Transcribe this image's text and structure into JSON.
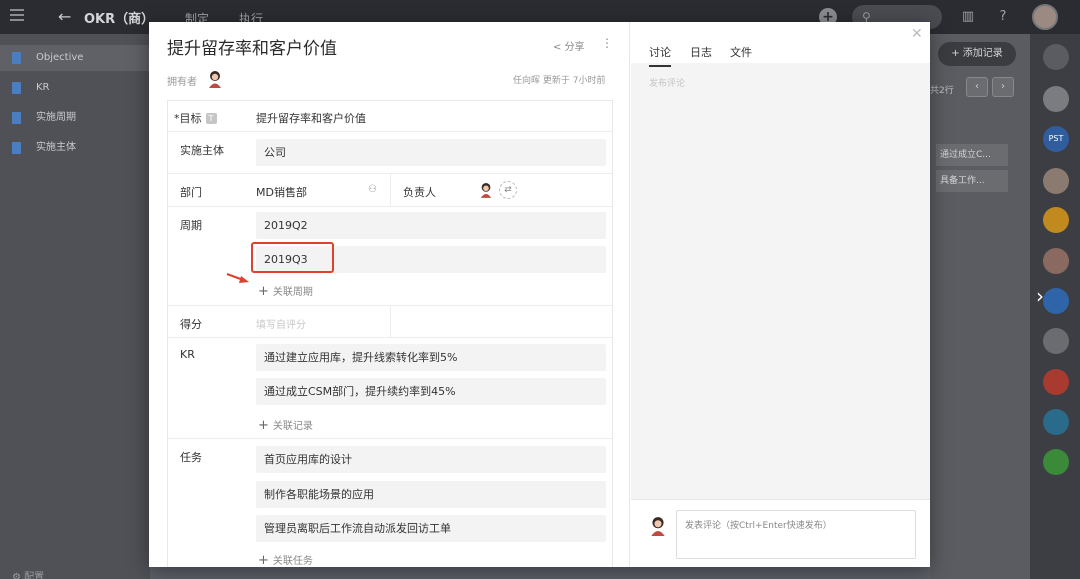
{
  "topbar": {
    "back_icon": "arrow-left-icon",
    "app_title": "OKR（商）",
    "tabs": [
      "制定",
      "执行"
    ],
    "search_icon": "search-icon"
  },
  "sidebar": {
    "items": [
      {
        "label": "Objective",
        "active": true
      },
      {
        "label": "KR",
        "active": false
      },
      {
        "label": "实施周期",
        "active": false
      },
      {
        "label": "实施主体",
        "active": false
      }
    ],
    "settings_label": "配置"
  },
  "background": {
    "add_record_label": "+ 添加记录",
    "pagination_label": "共2行",
    "cells": [
      "通过成立C...",
      "具备工作..."
    ]
  },
  "modal": {
    "title": "提升留存率和客户价值",
    "share_label": "分享",
    "owner_label": "拥有者",
    "meta": "任向晖 更新于 7小时前",
    "fields": {
      "goal": {
        "label": "目标",
        "value": "提升留存率和客户价值",
        "required_mark": "*",
        "type_badge": "T"
      },
      "entity": {
        "label": "实施主体",
        "value": "公司"
      },
      "dept": {
        "label": "部门",
        "value": "MD销售部",
        "owner_label": "负责人"
      },
      "period": {
        "label": "周期",
        "values": [
          "2019Q2",
          "2019Q3"
        ],
        "add_label": "关联周期"
      },
      "score": {
        "label": "得分",
        "placeholder": "填写自评分"
      },
      "kr": {
        "label": "KR",
        "values": [
          "通过建立应用库，提升线索转化率到5%",
          "通过成立CSM部门，提升续约率到45%"
        ],
        "add_label": "关联记录"
      },
      "tasks": {
        "label": "任务",
        "values": [
          "首页应用库的设计",
          "制作各职能场景的应用",
          "管理员离职后工作流自动派发回访工单"
        ],
        "add_label": "关联任务"
      }
    },
    "right": {
      "tabs": [
        "讨论",
        "日志",
        "文件"
      ],
      "comment_placeholder": "发布评论",
      "compose_placeholder": "发表评论（按Ctrl+Enter快速发布）"
    }
  },
  "colors": {
    "highlight": "#e0402e",
    "accent_blue": "#4a7ec0"
  }
}
